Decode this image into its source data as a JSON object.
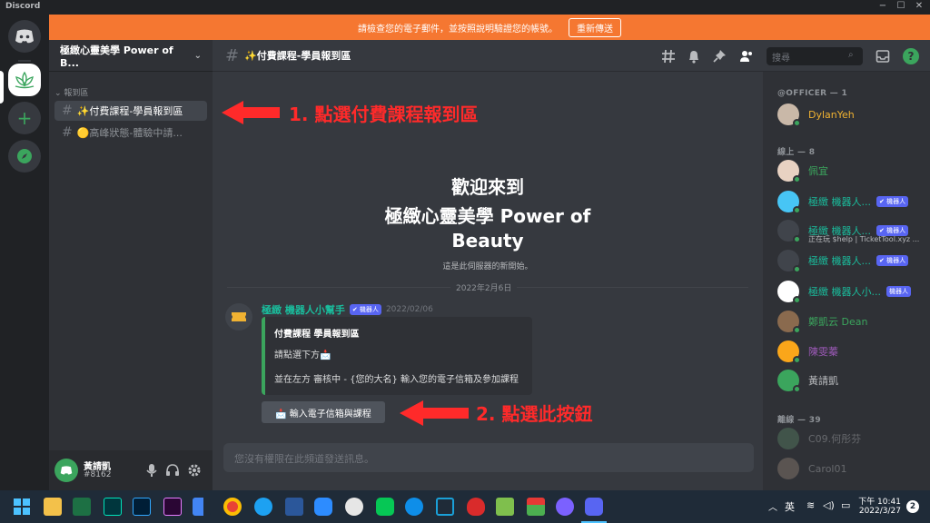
{
  "window": {
    "title": "Discord",
    "min": "−",
    "max": "☐",
    "close": "✕"
  },
  "banner": {
    "text": "請檢查您的電子郵件，並按照說明驗證您的帳號。",
    "button": "重新傳送"
  },
  "server": {
    "name": "極緻心靈美學 Power of B..."
  },
  "sidebar": {
    "category": "報到區",
    "channels": [
      {
        "label": "✨付費課程-學員報到區",
        "active": true
      },
      {
        "label": "🟡高峰狀態-體驗中請..."
      }
    ]
  },
  "chat": {
    "channel_title": "✨付費課程-學員報到區",
    "welcome_line1": "歡迎來到",
    "welcome_line2": "極緻心靈美學 Power of",
    "welcome_line3": "Beauty",
    "welcome_sub": "這是此伺服器的新開始。",
    "date_divider": "2022年2月6日",
    "message": {
      "author": "極緻 機器人小幫手",
      "bot_badge": "✔ 機器人",
      "timestamp": "2022/02/06",
      "embed_title": "付費課程 學員報到區",
      "embed_line1": "請點選下方📩",
      "embed_line2": "並在左方 審核中 - {您的大名} 輸入您的電子信箱及參加課程",
      "button_label": "📩 輸入電子信箱與課程"
    },
    "composer_placeholder": "您沒有權限在此頻道發送訊息。"
  },
  "header_tools": {
    "search_placeholder": "搜尋"
  },
  "annotations": {
    "step1": "1. 點選付費課程報到區",
    "step2": "2. 點選此按鈕"
  },
  "members": {
    "officer_title": "@OFFICER — 1",
    "online_title": "線上 — 8",
    "offline_title": "離線 — 39",
    "officer": [
      {
        "name": "DylanYeh",
        "color": "#f0b232"
      }
    ],
    "online": [
      {
        "name": "佩宜",
        "color": "#3ba55d",
        "badge": ""
      },
      {
        "name": "極緻 機器人...",
        "color": "#1abc9c",
        "badge": "✔ 機器人"
      },
      {
        "name": "極緻 機器人...",
        "color": "#1abc9c",
        "badge": "✔ 機器人",
        "status": "正在玩 $help | TicketTool.xyz ..."
      },
      {
        "name": "極緻 機器人...",
        "color": "#1abc9c",
        "badge": "✔ 機器人"
      },
      {
        "name": "極緻 機器人小...",
        "color": "#1abc9c",
        "badge": "機器人"
      },
      {
        "name": "鄭凱云 Dean",
        "color": "#3ba55d",
        "badge": ""
      },
      {
        "name": "陳雯蓁",
        "color": "#9b59b6",
        "badge": ""
      },
      {
        "name": "黃請凱",
        "color": "#b9bbbe",
        "badge": ""
      }
    ],
    "offline": [
      {
        "name": "C09.何彤芬"
      },
      {
        "name": "Carol01"
      }
    ]
  },
  "user": {
    "name": "黃請凱",
    "tag": "#8162"
  },
  "taskbar": {
    "ime": "英",
    "time": "下午 10:41",
    "date": "2022/3/27",
    "notif_count": "2"
  },
  "colors": {
    "accent": "#5865f2",
    "banner": "#f57731",
    "annotation": "#ff2a2a",
    "online": "#3ba55d"
  }
}
